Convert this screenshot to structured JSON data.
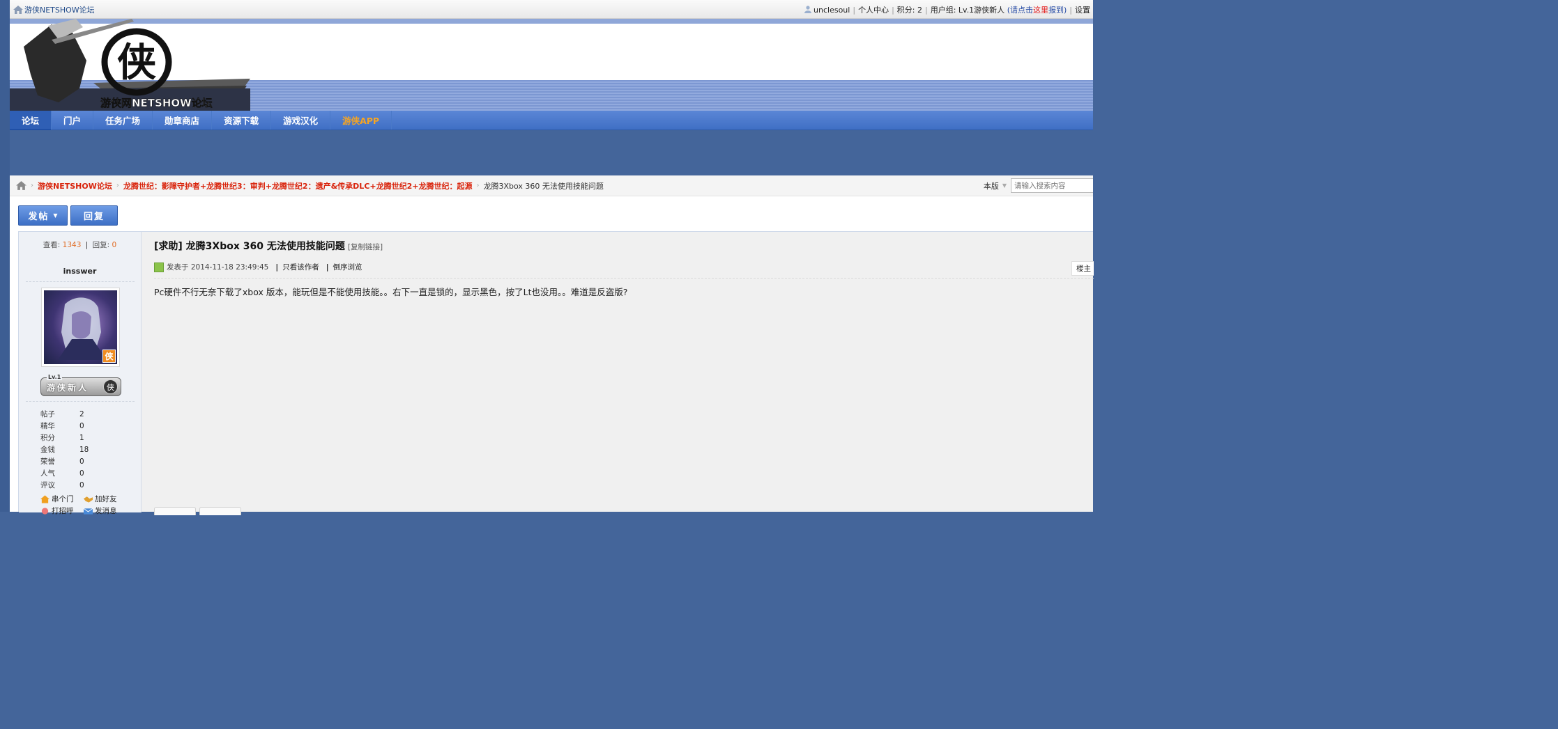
{
  "topbar": {
    "site_link": "游侠NETSHOW论坛",
    "username": "unclesoul",
    "personal_center": "个人中心",
    "points": "积分: 2",
    "usergroup": "用户组: Lv.1游侠新人",
    "checkin_prefix": "(请点击",
    "checkin_here": "这里",
    "checkin_suffix": "报到)",
    "settings": "设置"
  },
  "header": {
    "logo_text": "游侠网NETSHOW论坛",
    "logo_char": "侠"
  },
  "nav": {
    "items": [
      {
        "label": "论坛"
      },
      {
        "label": "门户"
      },
      {
        "label": "任务广场"
      },
      {
        "label": "勋章商店"
      },
      {
        "label": "资源下载"
      },
      {
        "label": "游戏汉化"
      },
      {
        "label": "游侠APP"
      }
    ]
  },
  "breadcrumb": {
    "forum": "游侠NETSHOW论坛",
    "board": "龙腾世纪：影障守护者+龙腾世纪3：审判+龙腾世纪2：遗产&传承DLC+龙腾世纪2+龙腾世纪：起源",
    "current": "龙腾3Xbox 360 无法使用技能问题",
    "search_scope": "本版",
    "search_placeholder": "请输入搜索内容"
  },
  "buttons": {
    "post": "发帖",
    "reply": "回复"
  },
  "thread": {
    "views_label": "查看:",
    "views": "1343",
    "replies_label": "回复:",
    "replies": "0",
    "title": "[求助] 龙腾3Xbox 360 无法使用技能问题",
    "copy_link": "[复制链接]",
    "posted_label": "发表于 2014-11-18 23:49:45",
    "only_author": "只看该作者",
    "reverse_view": "倒序浏览",
    "floor": "楼主",
    "body": "Pc硬件不行无奈下载了xbox 版本，能玩但是不能使用技能。。右下一直是锁的，显示黑色，按了Lt也没用。。难道是反盗版?"
  },
  "author": {
    "name": "insswer",
    "avatar_badge": "侠",
    "rank_level": "Lv.1",
    "rank_title": "游侠新人",
    "rank_seal": "侠",
    "stats": [
      {
        "label": "帖子",
        "value": "2"
      },
      {
        "label": "精华",
        "value": "0"
      },
      {
        "label": "积分",
        "value": "1"
      },
      {
        "label": "金钱",
        "value": "18"
      },
      {
        "label": "荣誉",
        "value": "0"
      },
      {
        "label": "人气",
        "value": "0"
      },
      {
        "label": "评议",
        "value": "0"
      }
    ],
    "actions": [
      {
        "label": "串个门",
        "icon": "home-icon"
      },
      {
        "label": "加好友",
        "icon": "handshake-icon"
      },
      {
        "label": "打招呼",
        "icon": "wave-icon"
      },
      {
        "label": "发消息",
        "icon": "mail-icon"
      }
    ]
  },
  "colors": {
    "background": "#44659a",
    "nav": "#3f6fc4",
    "accent_red": "#d9230b",
    "app_orange": "#f6a523"
  }
}
